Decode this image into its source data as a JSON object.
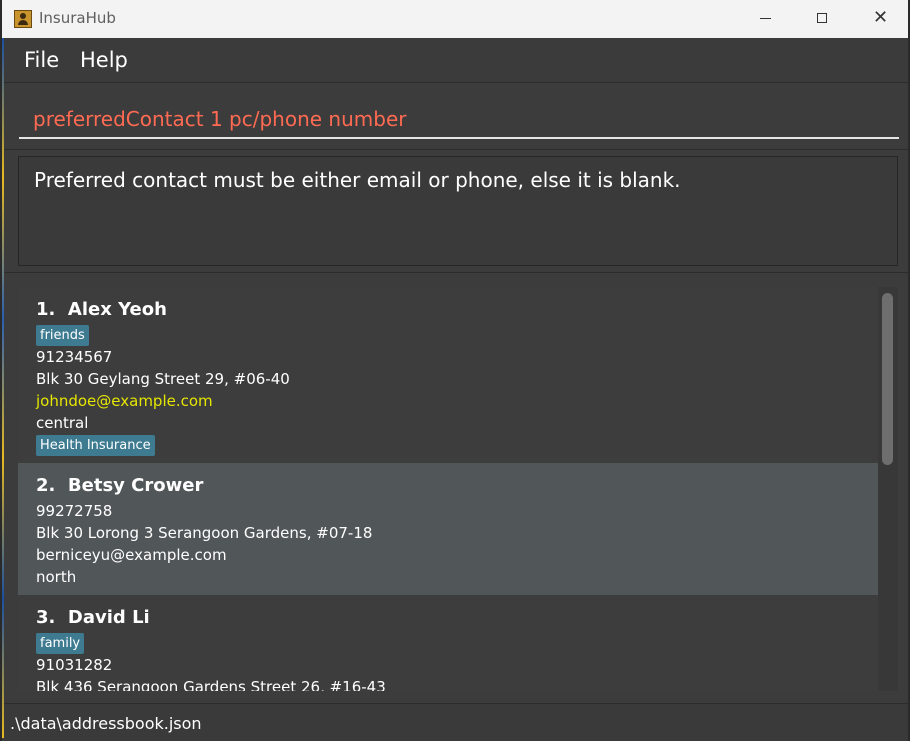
{
  "window": {
    "title": "InsuraHub",
    "icon": "addressbook-app-icon",
    "controls": {
      "minimize": "minimize-icon",
      "maximize": "maximize-icon",
      "close": "close-icon"
    }
  },
  "menu": {
    "file": "File",
    "help": "Help"
  },
  "command": {
    "value": "preferredContact 1 pc/phone number",
    "color": "#ff6a52"
  },
  "result": {
    "message": "Preferred contact must be either email or phone, else it is blank."
  },
  "persons": [
    {
      "index": "1.",
      "name": "Alex Yeoh",
      "tags": [
        "friends"
      ],
      "phone": "91234567",
      "address": "Blk 30 Geylang Street 29, #06-40",
      "email": "johndoe@example.com",
      "region": "central",
      "insurance": [
        "Health Insurance"
      ]
    },
    {
      "index": "2.",
      "name": "Betsy Crower",
      "tags": [],
      "phone": "99272758",
      "address": "Blk 30 Lorong 3 Serangoon Gardens, #07-18",
      "email": "berniceyu@example.com",
      "region": "north",
      "insurance": []
    },
    {
      "index": "3.",
      "name": "David Li",
      "tags": [
        "family"
      ],
      "phone": "91031282",
      "address": "Blk 436 Serangoon Gardens Street 26, #16-43",
      "email": "",
      "region": "",
      "insurance": []
    }
  ],
  "status": {
    "save_location": ".\\data\\addressbook.json"
  },
  "colors": {
    "background": "#3c3c3c",
    "card_selected": "#515658",
    "tag": "#3e7b91",
    "email_highlight": "#e6e600"
  }
}
